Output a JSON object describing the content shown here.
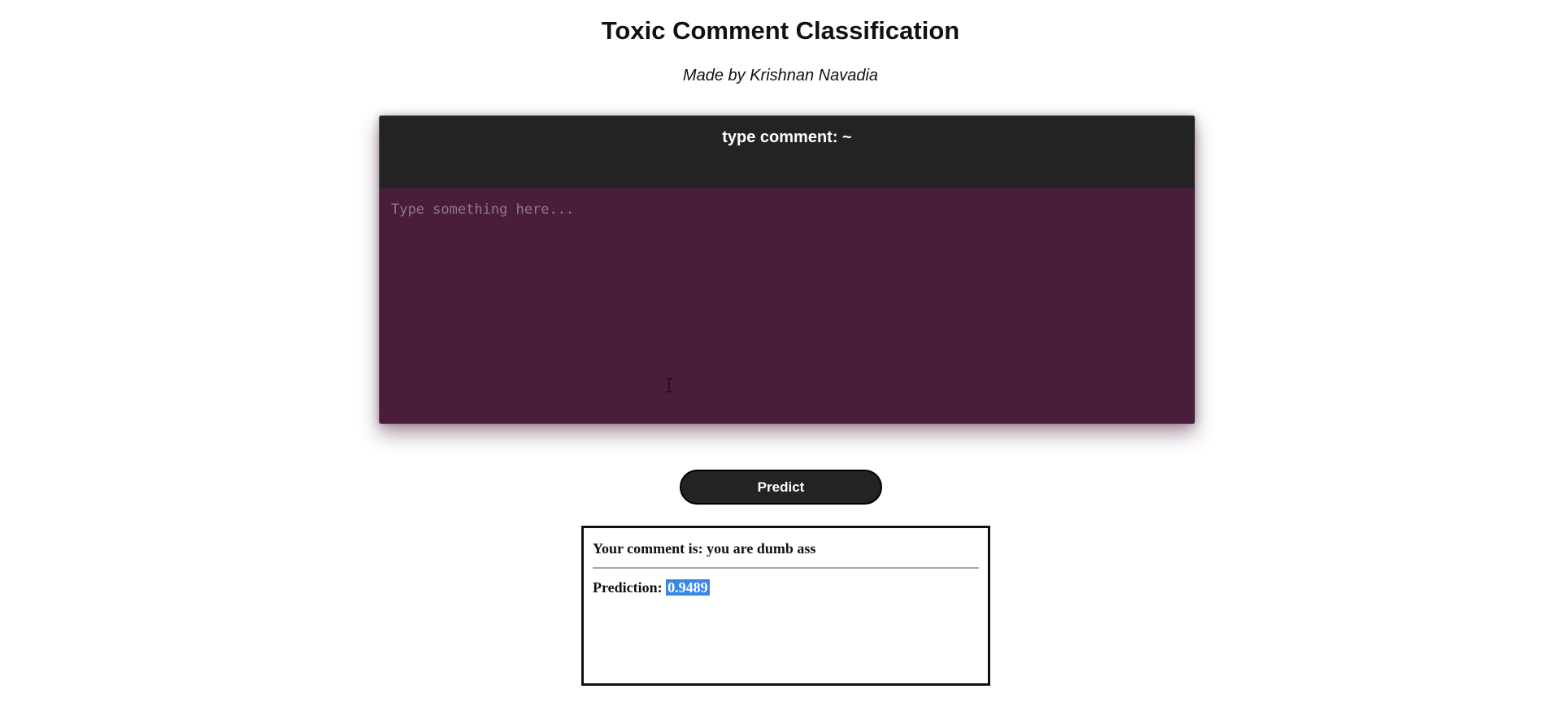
{
  "header": {
    "title": "Toxic Comment Classification",
    "subtitle": "Made by Krishnan Navadia"
  },
  "editor": {
    "label": "type comment: ~",
    "placeholder": "Type something here...",
    "value": ""
  },
  "actions": {
    "predict_label": "Predict"
  },
  "result": {
    "comment_prefix": "Your comment is: ",
    "comment_text": "you are dumb ass",
    "prediction_label": "Prediction:",
    "prediction_value": "0.9489"
  },
  "colors": {
    "editor_background": "#4a1d3d",
    "editor_header": "#232323",
    "button_background": "#232323",
    "selection_highlight": "#3a86e6"
  },
  "icons": {
    "cursor": "text-cursor-icon"
  }
}
